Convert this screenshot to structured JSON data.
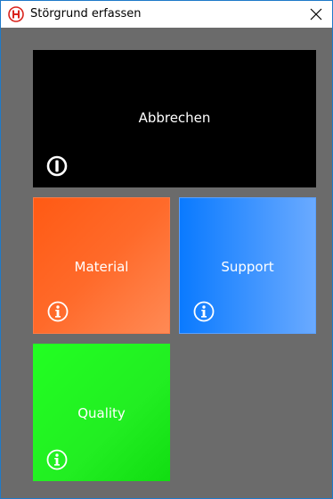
{
  "window": {
    "title": "Störgrund erfassen",
    "close_symbol": "✕",
    "app_icon": "company-logo-icon"
  },
  "tiles": [
    {
      "label": "Abbrechen",
      "icon": "power-icon",
      "color": "#000000"
    },
    {
      "label": "Material",
      "icon": "info-icon",
      "color": "#ff5a14"
    },
    {
      "label": "Support",
      "icon": "info-icon",
      "color": "#0a7aff"
    },
    {
      "label": "Quality",
      "icon": "info-icon",
      "color": "#22ff22"
    }
  ],
  "colors": {
    "background": "#6b6b6b",
    "window_border": "#1f7ac9",
    "logo_red": "#d9231c"
  }
}
